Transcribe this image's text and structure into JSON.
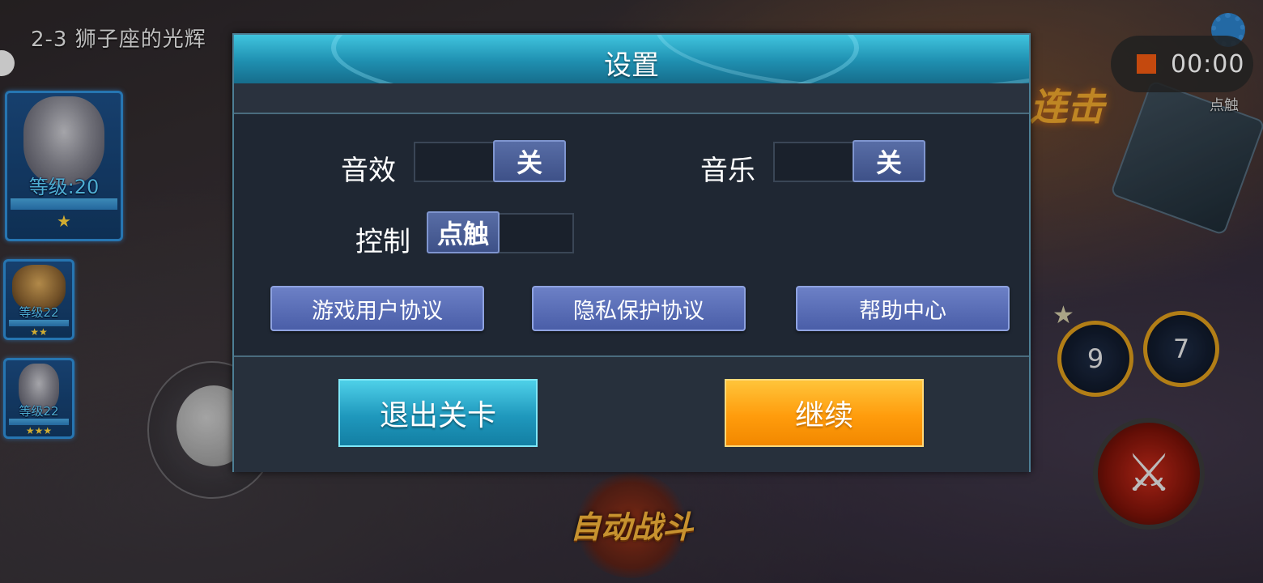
{
  "hud": {
    "level_title": "2-3 狮子座的光辉",
    "record_time": "00:00",
    "combo_text": "连击",
    "device_label": "点触",
    "skill_a_count": "9",
    "skill_b_count": "7",
    "auto_battle_label": "自动战斗"
  },
  "heroes": [
    {
      "level": "等级:20",
      "stars": "★"
    },
    {
      "level": "等级22",
      "stars": "★★"
    },
    {
      "level": "等级22",
      "stars": "★★★"
    }
  ],
  "settings": {
    "title": "设置",
    "sound_label": "音效",
    "sound_value": "关",
    "music_label": "音乐",
    "music_value": "关",
    "control_label": "控制",
    "control_value": "点触",
    "links": [
      "游戏用户协议",
      "隐私保护协议",
      "帮助中心"
    ],
    "exit_label": "退出关卡",
    "continue_label": "继续"
  },
  "colors": {
    "header_accent": "#2aaecf",
    "exit_button": "#1f98bd",
    "continue_button": "#ff9c0c",
    "link_button": "#5a6eb6",
    "record_dot": "#f05a12"
  }
}
